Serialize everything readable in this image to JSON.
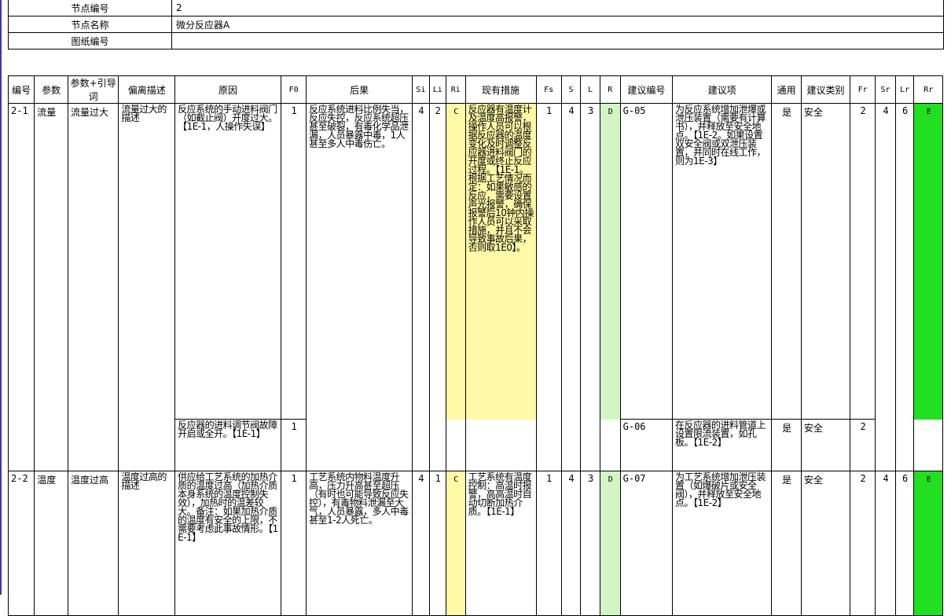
{
  "node_info": {
    "node_no_label": "节点编号",
    "node_no_value": "2",
    "node_name_label": "节点名称",
    "node_name_value": "微分反应器A",
    "drawing_no_label": "图纸编号",
    "drawing_no_value": ""
  },
  "headers": [
    "编号",
    "参数",
    "参数+引导词",
    "偏离描述",
    "原因",
    "F0",
    "后果",
    "Si",
    "Li",
    "Ri",
    "现有措施",
    "Fs",
    "S",
    "L",
    "R",
    "建议编号",
    "建议项",
    "通用",
    "建议类别",
    "Fr",
    "Sr",
    "Lr",
    "Rr"
  ],
  "rows": [
    {
      "id": "2-1",
      "param": "流量",
      "guideword": "流量过大",
      "deviation": "流量过大的描述",
      "cause_1": "反应系统的手动进料阀门（如截止阀）开度过大。【1E-1，人操作失误】",
      "f0_1": "1",
      "consequence": "反应系统进料比例失当，反应失控，反应系统超压甚至破裂，有毒化学品泄漏，人员暴露中毒，1人甚至多人中毒伤亡。",
      "si": "4",
      "li": "2",
      "ri": "C",
      "measures": "反应器有温度计及温度高报警，操作人员可以根据反应器的温度变化及时调整反应器进料阀门的开度或终止反应过程。【1E-1。根据工艺情况而定：如果敏感的反应，需要设置声光报警，确保报警后10钟内操作人员可以采取措施，并且不会导致事故后果，否则取1E0】。",
      "fs": "1",
      "s": "4",
      "l": "3",
      "r": "D",
      "rec_no_1": "G-05",
      "rec_1": "为反应系统增加泄爆或泄压装置（需要有计算书），并释放至安全地点。【1E-2。如果设置双安全阀或双泄压装置，并同时在线工作，则为1E-3】",
      "general_1": "是",
      "category_1": "安全",
      "fr_1": "2",
      "sr": "4",
      "lr": "6",
      "rr": "E",
      "cause_2": "反应器的进料调节阀故障开启或全开。【1E-1】",
      "f0_2": "1",
      "rec_no_2": "G-06",
      "rec_2": "在反应器的进料管道上设置限流装置，如孔板。【1E-2】",
      "general_2": "是",
      "category_2": "安全",
      "fr_2": "2"
    },
    {
      "id": "2-2",
      "param": "温度",
      "guideword": "温度过高",
      "deviation": "温度过高的描述",
      "cause_1": "供应给工艺系统的加热介质的温度过高（加热介质本身系统的温度控制失效），加热时的温差较大。备注：如果加热介质的温度有安全的上限，不需要考虑此事故情形。【1E-1】",
      "f0_1": "1",
      "consequence": "工艺系统内物料温度升高，压力升高甚至超压（有时也可能导致反应失控），有毒物料泄漏至大气，人员暴露，多人中毒甚至1-2人死亡。",
      "si": "4",
      "li": "1",
      "ri": "C",
      "measures": "工艺系统有温度控制：高温时报警，高高温时自动切断加热介质。【1E-1】",
      "fs": "1",
      "s": "4",
      "l": "3",
      "r": "D",
      "rec_no_1": "G-07",
      "rec_1": "为工艺系统增加泄压装置（如爆破片或安全阀），并释放至安全地点。【1E-2】",
      "general_1": "是",
      "category_1": "安全",
      "fr_1": "2",
      "sr": "4",
      "lr": "6",
      "rr": "E"
    }
  ]
}
